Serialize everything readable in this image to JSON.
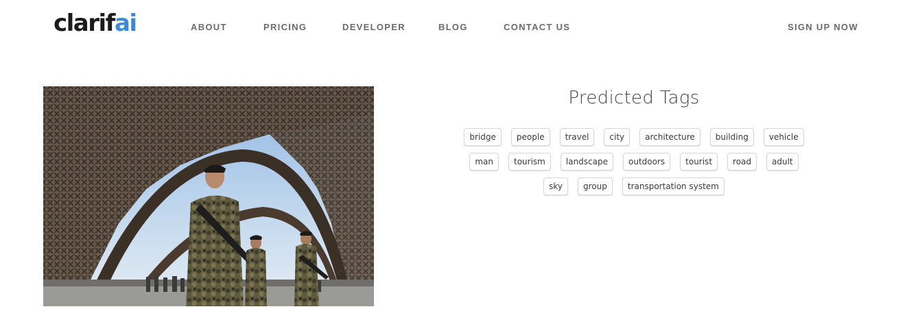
{
  "brand": {
    "logo_dark": "clarif",
    "logo_accent": "ai",
    "accent_color": "#3b8ad9"
  },
  "nav": {
    "items": [
      "ABOUT",
      "PRICING",
      "DEVELOPER",
      "BLOG",
      "CONTACT US"
    ],
    "signup": "SIGN UP NOW"
  },
  "photo": {
    "subject": "soldiers patrolling beneath the Eiffel Tower"
  },
  "tags": {
    "title": "Predicted Tags",
    "rows": [
      [
        "bridge",
        "people",
        "travel",
        "city",
        "architecture",
        "building",
        "vehicle"
      ],
      [
        "man",
        "tourism",
        "landscape",
        "outdoors",
        "tourist",
        "road",
        "adult"
      ],
      [
        "sky",
        "group",
        "transportation system"
      ]
    ]
  }
}
